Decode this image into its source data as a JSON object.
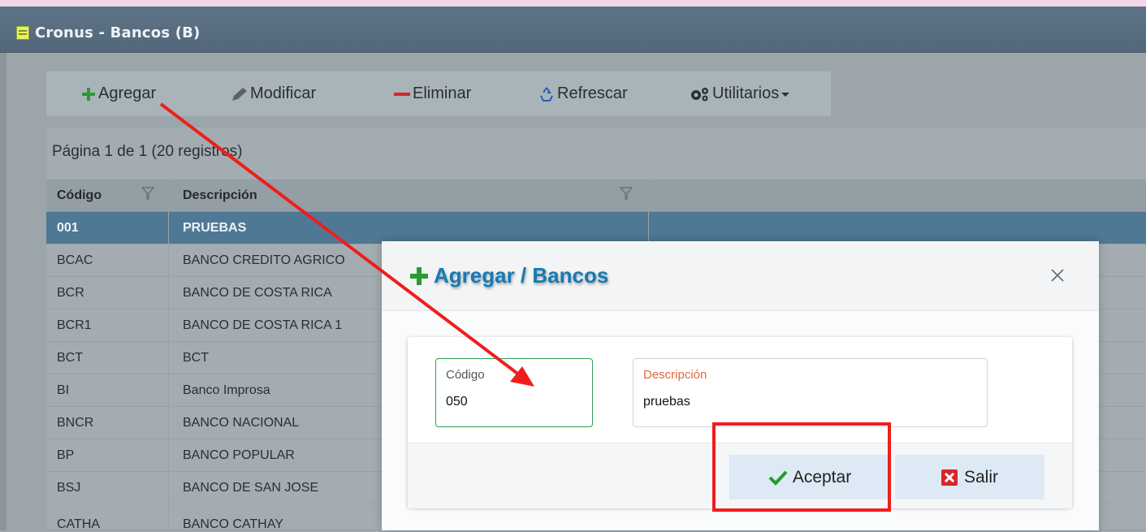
{
  "window": {
    "title": "Cronus - Bancos (B)"
  },
  "toolbar": {
    "add_label": "Agregar",
    "edit_label": "Modificar",
    "delete_label": "Eliminar",
    "refresh_label": "Refrescar",
    "utilities_label": "Utilitarios"
  },
  "grid": {
    "page_info": "Página 1 de 1 (20 registros)",
    "columns": [
      "Código",
      "Descripción"
    ],
    "rows": [
      [
        "001",
        "PRUEBAS"
      ],
      [
        "BCAC",
        "BANCO CREDITO AGRICO"
      ],
      [
        "BCR",
        "BANCO DE COSTA RICA"
      ],
      [
        "BCR1",
        "BANCO DE COSTA RICA 1"
      ],
      [
        "BCT",
        "BCT"
      ],
      [
        "BI",
        "Banco Improsa"
      ],
      [
        "BNCR",
        "BANCO NACIONAL"
      ],
      [
        "BP",
        "BANCO POPULAR"
      ],
      [
        "BSJ",
        "BANCO DE SAN JOSE"
      ],
      [
        "CATHA",
        "BANCO CATHAY"
      ]
    ]
  },
  "modal": {
    "title": "Agregar / Bancos",
    "codigo_label": "Código",
    "codigo_value": "050",
    "descripcion_label": "Descripción",
    "descripcion_value": "pruebas",
    "accept_label": "Aceptar",
    "exit_label": "Salir"
  },
  "colors": {
    "selected_row": "#4f7894",
    "modal_title": "#157ab5",
    "annotation": "#f01d1d",
    "add_icon": "#2a9a32"
  }
}
